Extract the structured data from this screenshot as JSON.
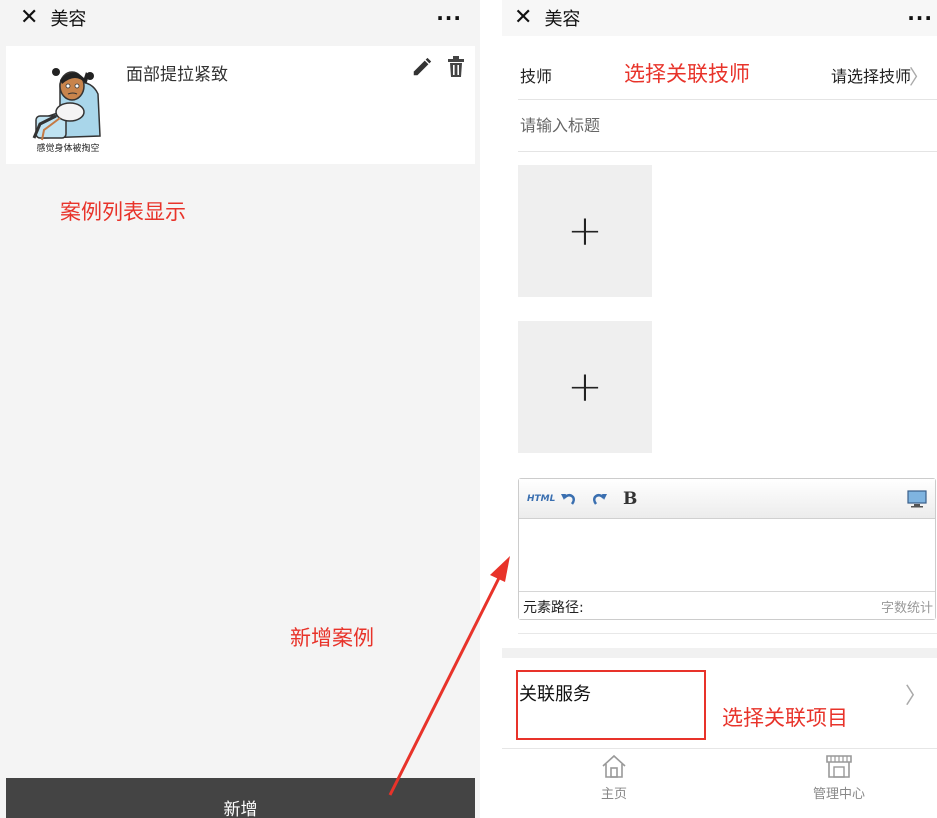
{
  "left_panel": {
    "header": {
      "title": "美容",
      "close_icon": "close-icon",
      "more_icon": "more-icon"
    },
    "case_list": [
      {
        "title": "面部提拉紧致",
        "thumb_caption": "感觉身体被掏空",
        "edit_icon": "pencil-icon",
        "delete_icon": "trash-icon"
      }
    ],
    "annotation_list": "案例列表显示",
    "annotation_add": "新增案例",
    "add_button_label": "新增"
  },
  "right_panel": {
    "header": {
      "title": "美容",
      "close_icon": "close-icon",
      "more_icon": "more-icon"
    },
    "technician": {
      "label": "技师",
      "value": "请选择技师",
      "annotation": "选择关联技师"
    },
    "title_input": {
      "placeholder": "请输入标题",
      "value": ""
    },
    "upload_slots": [
      {
        "icon": "plus-icon"
      },
      {
        "icon": "plus-icon"
      }
    ],
    "editor": {
      "toolbar": [
        {
          "name": "html-button",
          "label": "HTML"
        },
        {
          "name": "undo-button",
          "icon": "undo-icon"
        },
        {
          "name": "redo-button",
          "icon": "redo-icon"
        },
        {
          "name": "bold-button",
          "label": "B"
        },
        {
          "name": "fullscreen-button",
          "icon": "monitor-icon"
        }
      ],
      "element_path_label": "元素路径:",
      "word_count_label": "字数统计"
    },
    "related_service": {
      "label": "关联服务",
      "annotation": "选择关联项目"
    },
    "tabbar": [
      {
        "label": "主页",
        "icon": "home-icon"
      },
      {
        "label": "管理中心",
        "icon": "store-icon"
      }
    ]
  },
  "colors": {
    "annotation_red": "#e8332a",
    "add_bar": "#444444",
    "page_bg": "#f4f4f4",
    "link_blue": "#3a6fb0"
  }
}
